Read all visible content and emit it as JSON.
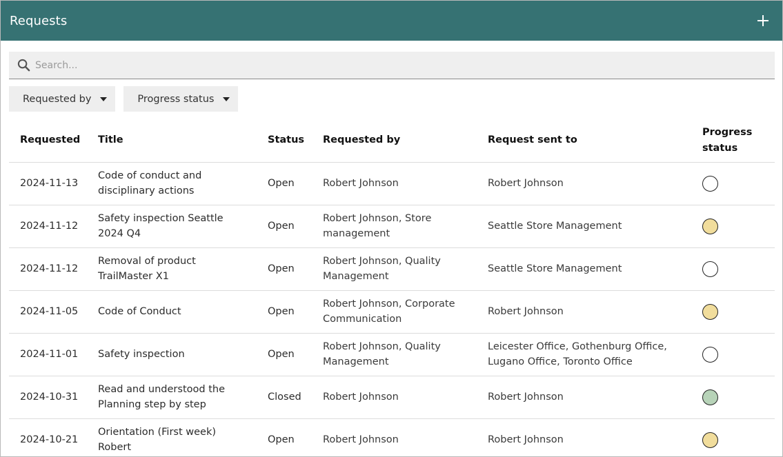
{
  "header": {
    "title": "Requests"
  },
  "search": {
    "placeholder": "Search..."
  },
  "filters": [
    {
      "label": "Requested by"
    },
    {
      "label": "Progress status"
    }
  ],
  "colors": {
    "header_bg": "#367273",
    "status_none": "#ffffff",
    "status_in_progress": "#f1dd9c",
    "status_done": "#b7d3b8"
  },
  "table": {
    "columns": [
      "Requested",
      "Title",
      "Status",
      "Requested by",
      "Request sent to",
      "Progress status"
    ],
    "rows": [
      {
        "requested": "2024-11-13",
        "title": "Code of conduct and disciplinary actions",
        "status": "Open",
        "requested_by": "Robert Johnson",
        "sent_to": "Robert Johnson",
        "progress": "none"
      },
      {
        "requested": "2024-11-12",
        "title": "Safety inspection Seattle 2024 Q4",
        "status": "Open",
        "requested_by": "Robert Johnson, Store management",
        "sent_to": "Seattle Store Management",
        "progress": "in_progress"
      },
      {
        "requested": "2024-11-12",
        "title": "Removal of product TrailMaster X1",
        "status": "Open",
        "requested_by": "Robert Johnson, Quality Management",
        "sent_to": "Seattle Store Management",
        "progress": "none"
      },
      {
        "requested": "2024-11-05",
        "title": "Code of Conduct",
        "status": "Open",
        "requested_by": "Robert Johnson, Corporate Communication",
        "sent_to": "Robert Johnson",
        "progress": "in_progress"
      },
      {
        "requested": "2024-11-01",
        "title": "Safety inspection",
        "status": "Open",
        "requested_by": "Robert Johnson, Quality Management",
        "sent_to": "Leicester Office, Gothenburg Office, Lugano Office, Toronto Office",
        "progress": "none"
      },
      {
        "requested": "2024-10-31",
        "title": "Read and understood the Planning step by step",
        "status": "Closed",
        "requested_by": "Robert Johnson",
        "sent_to": "Robert Johnson",
        "progress": "done"
      },
      {
        "requested": "2024-10-21",
        "title": "Orientation (First week) Robert",
        "status": "Open",
        "requested_by": "Robert Johnson",
        "sent_to": "Robert Johnson",
        "progress": "in_progress"
      }
    ]
  }
}
